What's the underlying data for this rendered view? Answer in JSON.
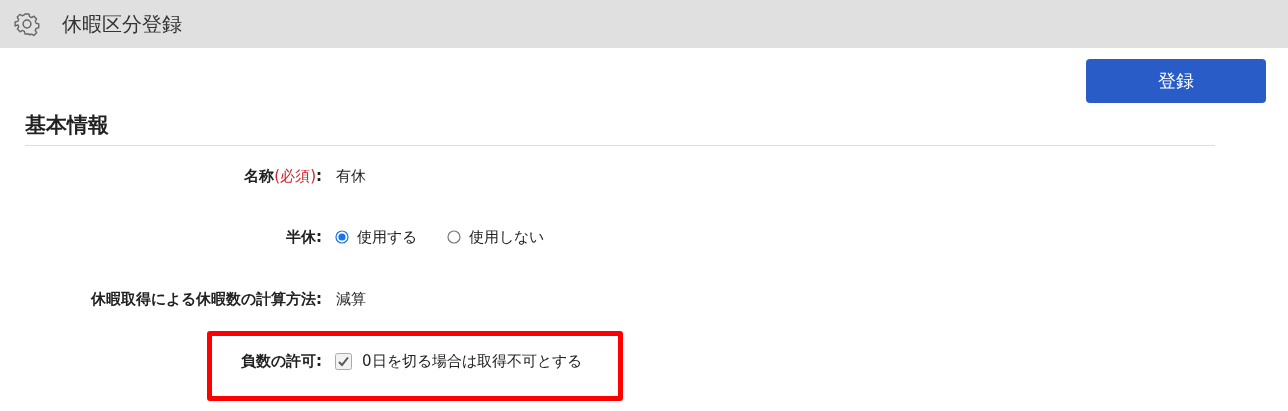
{
  "header": {
    "title": "休暇区分登録"
  },
  "actions": {
    "submit": "登録"
  },
  "section": {
    "title": "基本情報"
  },
  "fields": [
    {
      "kind": "text",
      "label": "名称",
      "required_note": "(必須)",
      "value": "有休",
      "separator": ":",
      "highlighted": false
    },
    {
      "kind": "radio",
      "label": "半休",
      "separator": ":",
      "options": [
        {
          "label": "使用する",
          "selected": true
        },
        {
          "label": "使用しない",
          "selected": false
        }
      ],
      "highlighted": false
    },
    {
      "kind": "text",
      "label": "休暇取得による休暇数の計算方法",
      "value": "減算",
      "separator": ":",
      "highlighted": false
    },
    {
      "kind": "checkbox",
      "label": "負数の許可",
      "separator": ":",
      "option": {
        "label": "0日を切る場合は取得不可とする",
        "checked": true
      },
      "highlighted": true
    }
  ]
}
